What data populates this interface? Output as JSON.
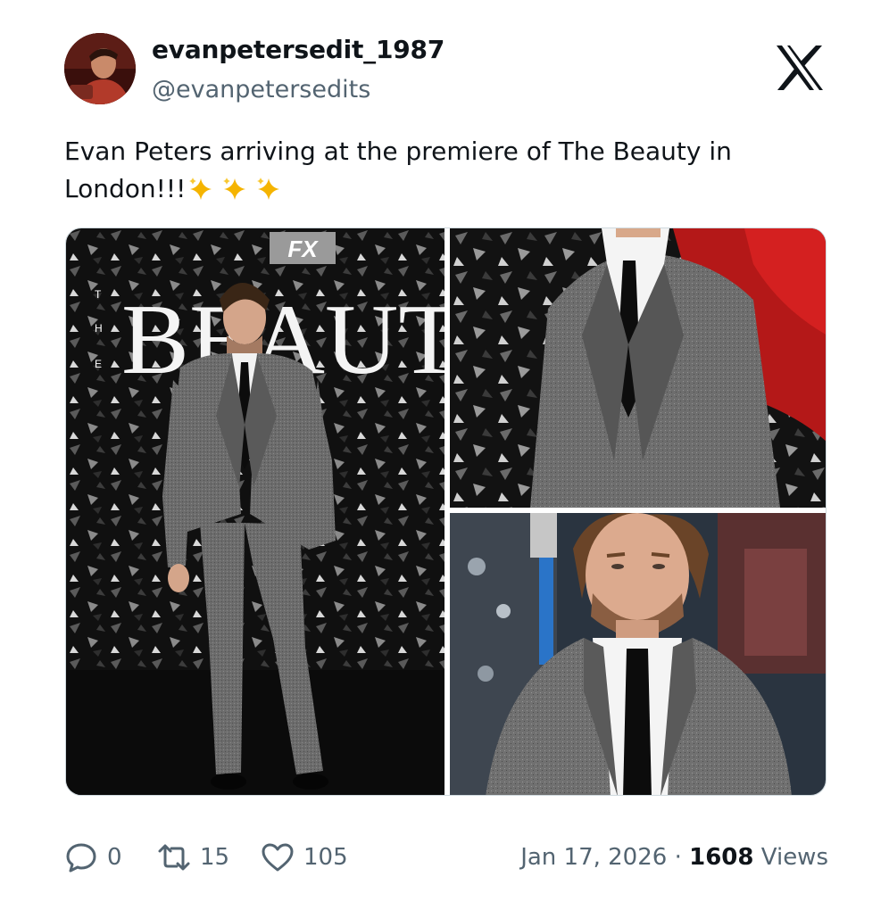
{
  "user": {
    "display_name": "evanpetersedit_1987",
    "handle": "@evanpetersedits"
  },
  "tweet": {
    "text": "Evan Peters arriving at the premiere of The Beauty in London!!!",
    "emoji": "✨✨✨"
  },
  "media": {
    "backdrop_letters": "BEAUT",
    "backdrop_side_letters": [
      "T",
      "H",
      "E"
    ],
    "network_badge": "FX"
  },
  "stats": {
    "replies": "0",
    "reposts": "15",
    "likes": "105"
  },
  "meta": {
    "date": "Jan 17, 2026",
    "separator": "·",
    "views_count": "1608",
    "views_label": "Views"
  },
  "colors": {
    "text": "#0f1419",
    "secondary": "#536471",
    "border": "#cfd9de",
    "sparkle": "#f5b400"
  },
  "icons": [
    "x-logo-icon",
    "reply-icon",
    "repost-icon",
    "like-icon",
    "sparkle-icon"
  ]
}
